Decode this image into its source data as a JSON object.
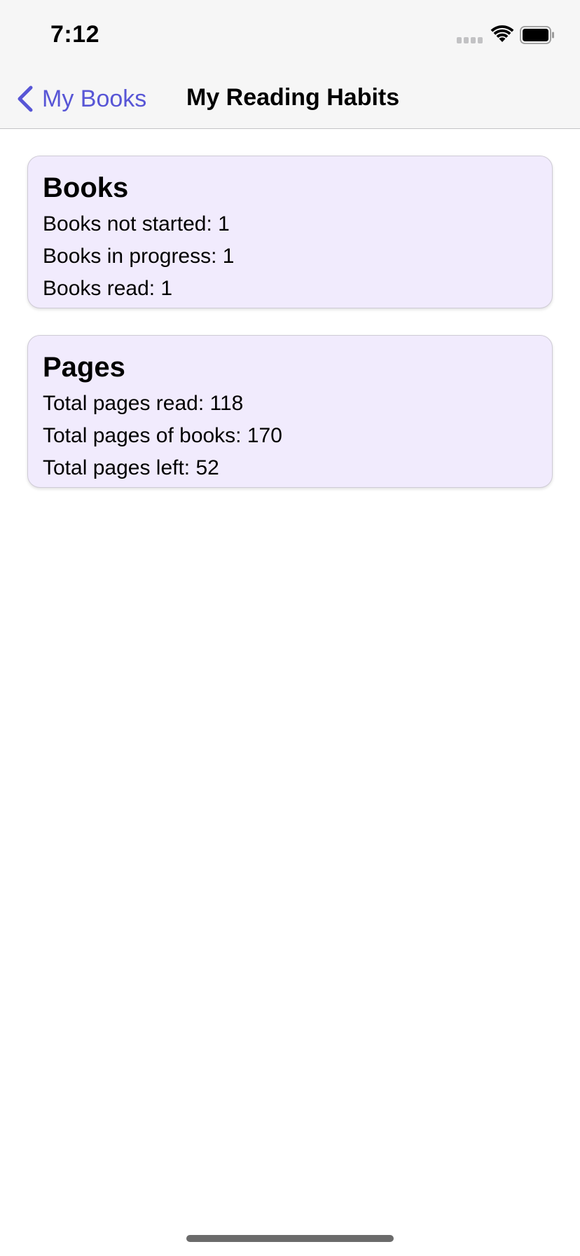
{
  "status_bar": {
    "time": "7:12"
  },
  "nav": {
    "back_label": "My Books",
    "title": "My Reading Habits"
  },
  "colors": {
    "accent": "#5856d6",
    "card_background": "#f1ebfd"
  },
  "icons": {
    "back": "chevron-left-icon",
    "signal": "signal-icon",
    "wifi": "wifi-icon",
    "battery": "battery-icon"
  },
  "cards": [
    {
      "title": "Books",
      "lines": [
        "Books not started: 1",
        "Books in progress: 1",
        "Books read: 1"
      ]
    },
    {
      "title": "Pages",
      "lines": [
        "Total pages read: 118",
        "Total pages of books: 170",
        "Total pages left: 52"
      ]
    }
  ]
}
